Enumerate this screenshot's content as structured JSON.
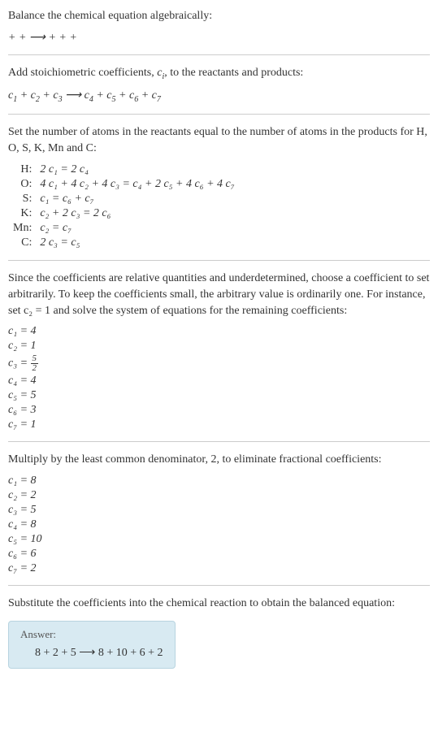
{
  "title": "Balance the chemical equation algebraically:",
  "unbalanced": " +  +  ⟶  +  +  + ",
  "stoich_intro": "Add stoichiometric coefficients, ",
  "stoich_var": "c",
  "stoich_sub": "i",
  "stoich_rest": ", to the reactants and products:",
  "stoich_eqn_parts": [
    "c",
    "1",
    "  + c",
    "2",
    "  + c",
    "3",
    "   ⟶  c",
    "4",
    "  + c",
    "5",
    "  + c",
    "6",
    "  + c",
    "7",
    " "
  ],
  "set_atoms_intro": "Set the number of atoms in the reactants equal to the number of atoms in the products for H, O, S, K, Mn and C:",
  "atoms": [
    {
      "el": "H:",
      "eq": "2 c₁ = 2 c₄"
    },
    {
      "el": "O:",
      "eq": "4 c₁ + 4 c₂ + 4 c₃ = c₄ + 2 c₅ + 4 c₆ + 4 c₇"
    },
    {
      "el": "S:",
      "eq": "c₁ = c₆ + c₇"
    },
    {
      "el": "K:",
      "eq": "c₂ + 2 c₃ = 2 c₆"
    },
    {
      "el": "Mn:",
      "eq": "c₂ = c₇"
    },
    {
      "el": "C:",
      "eq": "2 c₃ = c₅"
    }
  ],
  "underdet_text": "Since the coefficients are relative quantities and underdetermined, choose a coefficient to set arbitrarily. To keep the coefficients small, the arbitrary value is ordinarily one. For instance, set c₂ = 1 and solve the system of equations for the remaining coefficients:",
  "coefs1": [
    {
      "lhs": "c₁ = ",
      "rhs": "4"
    },
    {
      "lhs": "c₂ = ",
      "rhs": "1"
    },
    {
      "lhs": "c₃ = ",
      "rhs_frac": {
        "num": "5",
        "den": "2"
      }
    },
    {
      "lhs": "c₄ = ",
      "rhs": "4"
    },
    {
      "lhs": "c₅ = ",
      "rhs": "5"
    },
    {
      "lhs": "c₆ = ",
      "rhs": "3"
    },
    {
      "lhs": "c₇ = ",
      "rhs": "1"
    }
  ],
  "mult_text": "Multiply by the least common denominator, 2, to eliminate fractional coefficients:",
  "coefs2": [
    {
      "lhs": "c₁ = ",
      "rhs": "8"
    },
    {
      "lhs": "c₂ = ",
      "rhs": "2"
    },
    {
      "lhs": "c₃ = ",
      "rhs": "5"
    },
    {
      "lhs": "c₄ = ",
      "rhs": "8"
    },
    {
      "lhs": "c₅ = ",
      "rhs": "10"
    },
    {
      "lhs": "c₆ = ",
      "rhs": "6"
    },
    {
      "lhs": "c₇ = ",
      "rhs": "2"
    }
  ],
  "subst_text": "Substitute the coefficients into the chemical reaction to obtain the balanced equation:",
  "answer_label": "Answer:",
  "answer_eqn": "8  + 2  + 5  ⟶ 8  + 10  + 6  + 2 "
}
